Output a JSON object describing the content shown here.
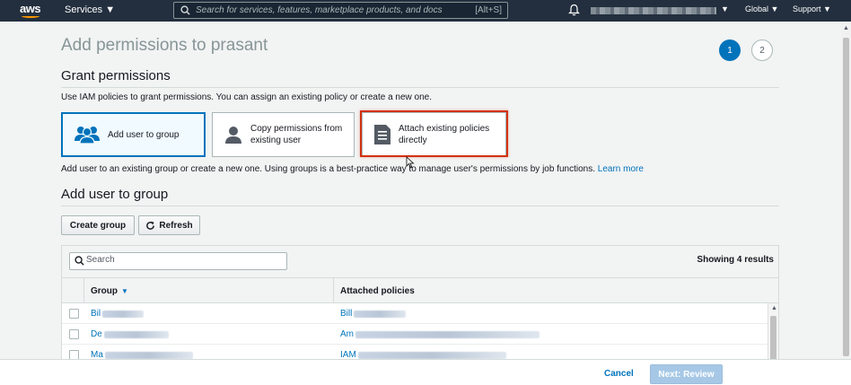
{
  "nav": {
    "logo": "aws",
    "services_label": "Services",
    "search_placeholder": "Search for services, features, marketplace products, and docs",
    "search_shortcut": "[Alt+S]",
    "global_label": "Global",
    "support_label": "Support"
  },
  "page": {
    "title": "Add permissions to prasant",
    "steps": [
      "1",
      "2"
    ],
    "current_step": "1"
  },
  "grant": {
    "heading": "Grant permissions",
    "description": "Use IAM policies to grant permissions. You can assign an existing policy or create a new one.",
    "options": [
      {
        "label": "Add user to group",
        "icon": "users-group-icon",
        "selected": true
      },
      {
        "label": "Copy permissions from existing user",
        "icon": "user-icon",
        "selected": false
      },
      {
        "label": "Attach existing policies directly",
        "icon": "document-icon",
        "selected": false
      }
    ],
    "option_description": "Add user to an existing group or create a new one. Using groups is a best-practice way to manage user's permissions by job functions.",
    "learn_more": "Learn more"
  },
  "group_section": {
    "heading": "Add user to group",
    "create_group_label": "Create group",
    "refresh_label": "Refresh",
    "search_placeholder": "Search",
    "results_text": "Showing 4 results",
    "columns": [
      "Group",
      "Attached policies"
    ],
    "rows": [
      {
        "group": "Bil",
        "policies": "Bill"
      },
      {
        "group": "De",
        "policies": "Am"
      },
      {
        "group": "Ma",
        "policies": "IAM"
      }
    ]
  },
  "footer": {
    "cancel_label": "Cancel",
    "next_label": "Next: Review"
  },
  "colors": {
    "nav_bg": "#232f3e",
    "primary": "#0073bb",
    "highlight": "#d13212",
    "disabled_primary": "#a6c8e6"
  }
}
